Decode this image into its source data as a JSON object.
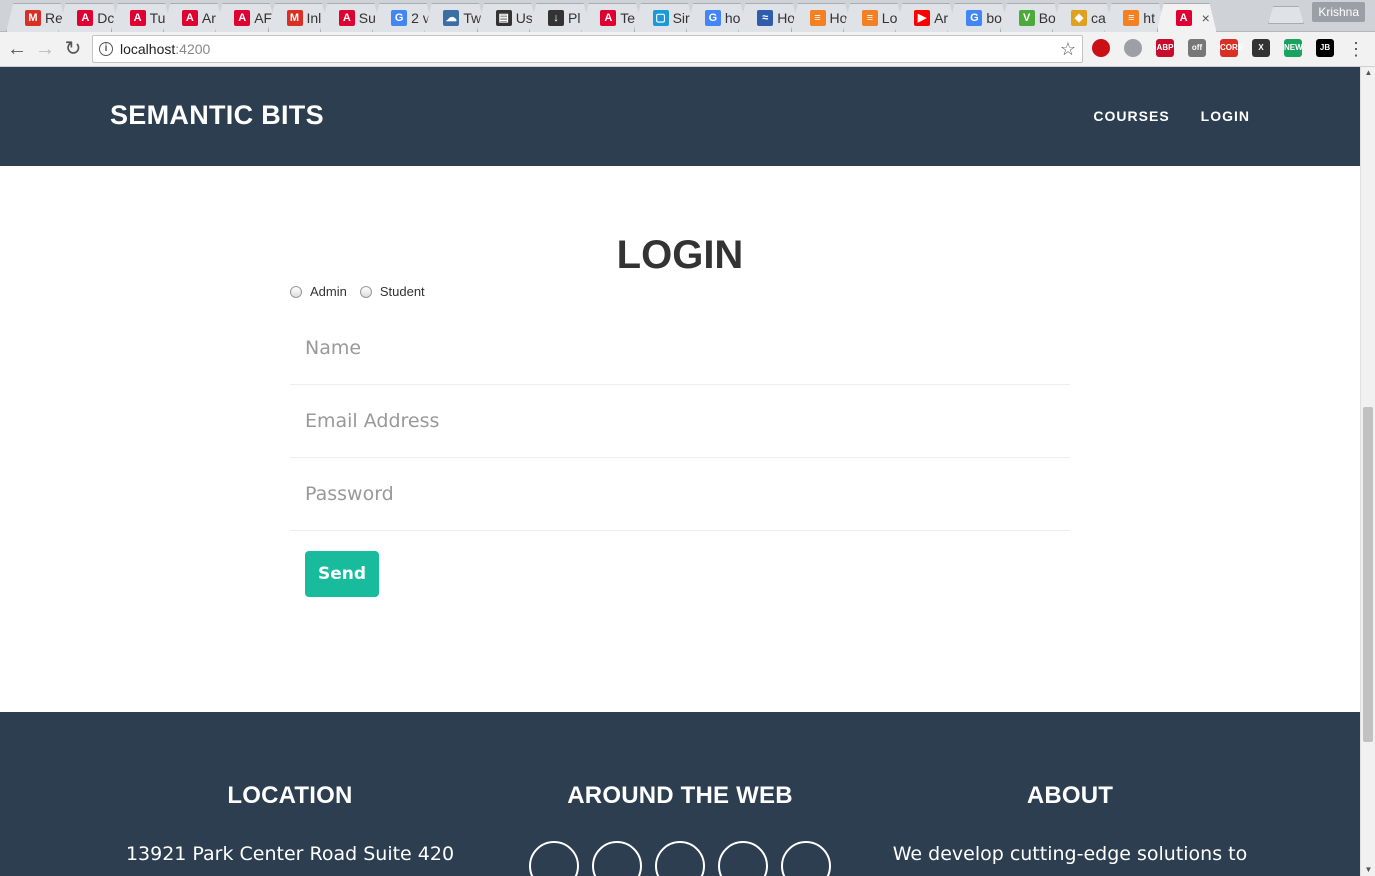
{
  "browser": {
    "tabs": [
      {
        "label": "Re",
        "icon": "gmail-icon",
        "color": "#d93025"
      },
      {
        "label": "Dc",
        "icon": "angular-icon",
        "color": "#dd0031"
      },
      {
        "label": "Tu",
        "icon": "angular-icon",
        "color": "#dd0031"
      },
      {
        "label": "Ar",
        "icon": "angular-icon",
        "color": "#dd0031"
      },
      {
        "label": "AF",
        "icon": "angular-icon",
        "color": "#dd0031"
      },
      {
        "label": "Inl",
        "icon": "gmail-icon",
        "color": "#d93025"
      },
      {
        "label": "Su",
        "icon": "angular-icon",
        "color": "#dd0031"
      },
      {
        "label": "2 v",
        "icon": "google-icon",
        "color": "#4285f4"
      },
      {
        "label": "Tw",
        "icon": "cloud-icon",
        "color": "#3b6ea5"
      },
      {
        "label": "Us",
        "icon": "book-icon",
        "color": "#333333"
      },
      {
        "label": "Pl",
        "icon": "download-icon",
        "color": "#333333"
      },
      {
        "label": "Te",
        "icon": "angular-icon",
        "color": "#dd0031"
      },
      {
        "label": "Sir",
        "icon": "box-icon",
        "color": "#1a9ad6"
      },
      {
        "label": "ho",
        "icon": "google-icon",
        "color": "#4285f4"
      },
      {
        "label": "Ho",
        "icon": "wave-icon",
        "color": "#2f5dae"
      },
      {
        "label": "Ho",
        "icon": "stackoverflow-icon",
        "color": "#f48024"
      },
      {
        "label": "Lo",
        "icon": "stackoverflow-icon",
        "color": "#f48024"
      },
      {
        "label": "Ar",
        "icon": "youtube-icon",
        "color": "#ff0000"
      },
      {
        "label": "bo",
        "icon": "google-icon",
        "color": "#4285f4"
      },
      {
        "label": "Bo",
        "icon": "vim-icon",
        "color": "#4ea93b"
      },
      {
        "label": "ca",
        "icon": "logo-icon",
        "color": "#e0a020"
      },
      {
        "label": "ht",
        "icon": "stackoverflow-icon",
        "color": "#f48024"
      },
      {
        "label": "",
        "icon": "angular-icon",
        "color": "#dd0031",
        "active": true
      }
    ],
    "profile_name": "Krishna",
    "address_host": "localhost",
    "address_port": ":4200",
    "extensions": [
      {
        "icon": "opera-icon",
        "text": "",
        "color": "#cc0f16"
      },
      {
        "icon": "shield-icon",
        "text": "",
        "color": "#9aa0a6"
      },
      {
        "icon": "adblock-icon",
        "text": "ABP",
        "color": "#c70d2c"
      },
      {
        "icon": "off-icon",
        "text": "off",
        "color": "#777777"
      },
      {
        "icon": "cors-icon",
        "text": "CORS",
        "color": "#d93025"
      },
      {
        "icon": "x-icon",
        "text": "X",
        "color": "#333333"
      },
      {
        "icon": "new-icon",
        "text": "NEW",
        "color": "#1aa260"
      },
      {
        "icon": "jetbrains-icon",
        "text": "JB",
        "color": "#000000"
      }
    ]
  },
  "site": {
    "brand": "SEMANTIC BITS",
    "nav": {
      "courses": "COURSES",
      "login": "LOGIN"
    },
    "colors": {
      "navbar": "#2c3e50",
      "accent": "#18bc9c"
    }
  },
  "login": {
    "title": "LOGIN",
    "roles": [
      "Admin",
      "Student"
    ],
    "name_placeholder": "Name",
    "email_placeholder": "Email Address",
    "password_placeholder": "Password",
    "send_label": "Send"
  },
  "footer": {
    "location_title": "LOCATION",
    "location_text": "13921 Park Center Road Suite 420",
    "web_title": "AROUND THE WEB",
    "about_title": "ABOUT",
    "about_text": "We develop cutting-edge solutions to"
  }
}
